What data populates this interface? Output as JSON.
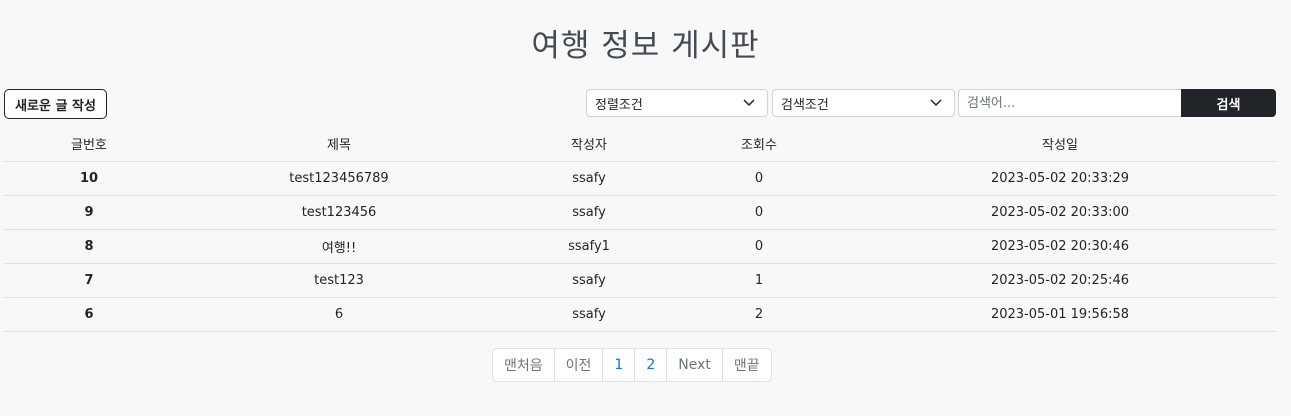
{
  "page": {
    "title": "여행 정보 게시판"
  },
  "toolbar": {
    "new_post_label": "새로운 글 작성",
    "sort_select": "정렬조건",
    "search_select": "검색조건",
    "search_placeholder": "검색어...",
    "search_button": "검색"
  },
  "table": {
    "headers": [
      "글번호",
      "제목",
      "작성자",
      "조회수",
      "작성일"
    ],
    "rows": [
      [
        "10",
        "test123456789",
        "ssafy",
        "0",
        "2023-05-02 20:33:29"
      ],
      [
        "9",
        "test123456",
        "ssafy",
        "0",
        "2023-05-02 20:33:00"
      ],
      [
        "8",
        "여행!!",
        "ssafy1",
        "0",
        "2023-05-02 20:30:46"
      ],
      [
        "7",
        "test123",
        "ssafy",
        "1",
        "2023-05-02 20:25:46"
      ],
      [
        "6",
        "6",
        "ssafy",
        "2",
        "2023-05-01 19:56:58"
      ]
    ]
  },
  "pagination": {
    "first": "맨처음",
    "prev": "이전",
    "pages": [
      "1",
      "2"
    ],
    "next": "Next",
    "last": "맨끝"
  },
  "icons": {
    "select_chevron": "chevron-down-icon"
  },
  "colors": {
    "dark": "#212529",
    "link": "#0d6efd",
    "muted": "#6c757d"
  }
}
